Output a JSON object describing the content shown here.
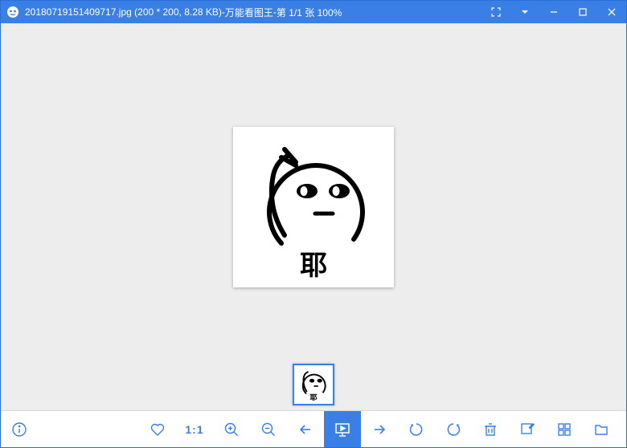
{
  "title": {
    "filename": "20180719151409717.jpg",
    "dimensions": "(200 * 200, 8.28 KB)",
    "sep": " - ",
    "appname": "万能看图王",
    "page": "第 1/1 张 100%"
  },
  "image": {
    "caption": "耶"
  },
  "toolbar": {
    "ratio": "1:1"
  }
}
